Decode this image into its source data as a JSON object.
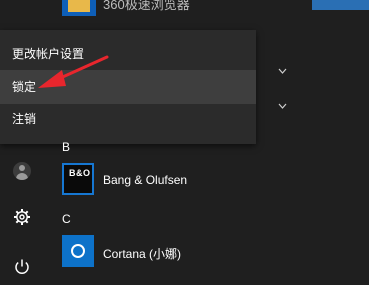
{
  "start": {
    "top_app_label": "360极速浏览器",
    "menu": {
      "items": [
        {
          "label": "更改帐户设置"
        },
        {
          "label": "锁定"
        },
        {
          "label": "注销"
        }
      ]
    },
    "sections": [
      {
        "letter": "B",
        "apps": [
          {
            "label": "Bang & Olufsen",
            "tile_text": "B&O"
          }
        ]
      },
      {
        "letter": "C",
        "apps": [
          {
            "label": "Cortana (小娜)"
          }
        ]
      }
    ],
    "rail": {
      "icons": [
        "user-avatar-icon",
        "settings-gear-icon",
        "power-icon"
      ]
    },
    "colors": {
      "accent": "#0d72c9",
      "annotation_arrow": "#e8262d"
    }
  }
}
